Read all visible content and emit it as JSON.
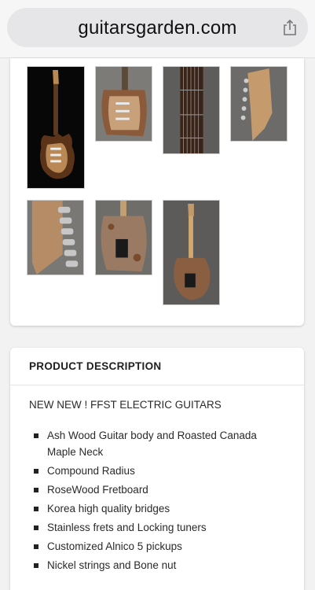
{
  "browser": {
    "url": "guitarsgarden.com",
    "share_icon": "share-icon"
  },
  "gallery": {
    "images": [
      {
        "name": "guitar-full-front",
        "alt": "front"
      },
      {
        "name": "guitar-body-closeup",
        "alt": "body"
      },
      {
        "name": "guitar-fretboard",
        "alt": "fretboard"
      },
      {
        "name": "guitar-headstock",
        "alt": "headstock"
      },
      {
        "name": "guitar-tuners",
        "alt": "tuners"
      },
      {
        "name": "guitar-back-body",
        "alt": "back body"
      },
      {
        "name": "guitar-full-back",
        "alt": "back"
      }
    ]
  },
  "description": {
    "header": "PRODUCT DESCRIPTION",
    "subtitle": "NEW NEW ! FFST ELECTRIC GUITARS",
    "features": [
      "Ash Wood Guitar body and Roasted Canada Maple Neck",
      "Compound Radius",
      "RoseWood Fretboard",
      "Korea high quality bridges",
      "Stainless frets and Locking tuners",
      "Customized Alnico 5 pickups",
      "Nickel strings and Bone nut"
    ]
  }
}
